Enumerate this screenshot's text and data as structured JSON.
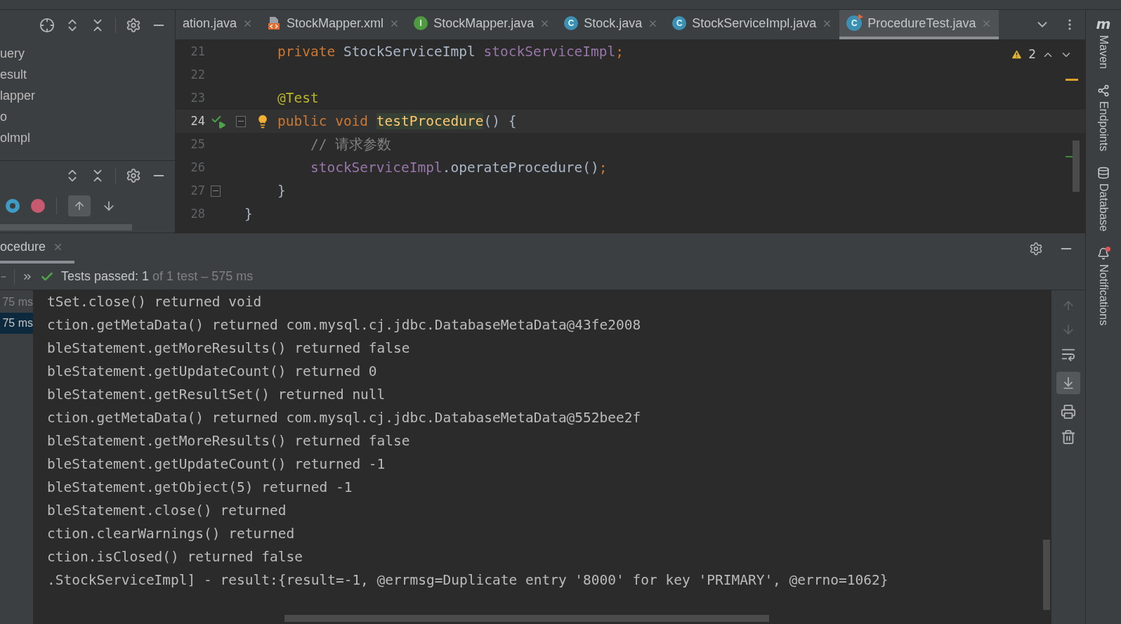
{
  "left_panel": {
    "tree_items": [
      "uery",
      "esult",
      "lapper",
      "o",
      "olmpl"
    ]
  },
  "editor": {
    "tabs": [
      {
        "label": "ation.java",
        "kind": "none",
        "selected": false
      },
      {
        "label": "StockMapper.xml",
        "kind": "xml",
        "selected": false
      },
      {
        "label": "StockMapper.java",
        "kind": "interface",
        "glyph": "I",
        "selected": false
      },
      {
        "label": "Stock.java",
        "kind": "class",
        "glyph": "C",
        "selected": false
      },
      {
        "label": "StockServiceImpl.java",
        "kind": "class",
        "glyph": "C",
        "selected": false
      },
      {
        "label": "ProcedureTest.java",
        "kind": "test",
        "glyph": "C",
        "selected": true
      }
    ],
    "warning_count": "2",
    "lines": [
      {
        "number": "21",
        "current": false,
        "tokens": [
          {
            "text": "    private ",
            "kind": "keyword"
          },
          {
            "text": "StockServiceImpl ",
            "kind": "plain"
          },
          {
            "text": "stockServiceImpl",
            "kind": "field"
          },
          {
            "text": ";",
            "kind": "keyword"
          }
        ]
      },
      {
        "number": "22",
        "current": false
      },
      {
        "number": "23",
        "current": false,
        "tokens": [
          {
            "text": "    @Test",
            "kind": "annotation"
          }
        ]
      },
      {
        "number": "24",
        "current": true,
        "marks": [
          {
            "kind": "run"
          },
          {
            "kind": "fold-start"
          },
          {
            "kind": "bulb"
          }
        ],
        "tokens": [
          {
            "text": "    public void ",
            "kind": "keyword"
          },
          {
            "text": "testProcedure",
            "kind": "method",
            "highlighted": true
          },
          {
            "text": "() {",
            "kind": "plain"
          }
        ]
      },
      {
        "number": "25",
        "current": false,
        "tokens": [
          {
            "text": "        // 请求参数",
            "kind": "comment"
          }
        ]
      },
      {
        "number": "26",
        "current": false,
        "tokens": [
          {
            "text": "        stockServiceImpl",
            "kind": "field"
          },
          {
            "text": ".operateProcedure()",
            "kind": "plain"
          },
          {
            "text": ";",
            "kind": "keyword"
          }
        ]
      },
      {
        "number": "27",
        "current": false,
        "marks": [
          {
            "kind": "fold-end"
          }
        ],
        "tokens": [
          {
            "text": "    }",
            "kind": "plain"
          }
        ]
      },
      {
        "number": "28",
        "current": false,
        "tokens": [
          {
            "text": "}",
            "kind": "plain"
          }
        ]
      }
    ]
  },
  "right_sidebar": [
    {
      "label": "Maven",
      "kind": "maven",
      "glyph": "m"
    },
    {
      "label": "Endpoints",
      "kind": "endpoints"
    },
    {
      "label": "Database",
      "kind": "database"
    },
    {
      "label": "Notifications",
      "kind": "notifications"
    }
  ],
  "run_panel": {
    "tab": "ocedure",
    "status": {
      "passed": "Tests passed: 1",
      "rest": "of 1 test – 575 ms"
    },
    "durations": [
      {
        "text": "75 ms",
        "selected": false
      },
      {
        "text": "75 ms",
        "selected": true
      }
    ],
    "console_lines": [
      "tSet.close() returned void",
      "ction.getMetaData() returned com.mysql.cj.jdbc.DatabaseMetaData@43fe2008",
      "bleStatement.getMoreResults() returned false",
      "bleStatement.getUpdateCount() returned 0",
      "bleStatement.getResultSet() returned null",
      "ction.getMetaData() returned com.mysql.cj.jdbc.DatabaseMetaData@552bee2f",
      "bleStatement.getMoreResults() returned false",
      "bleStatement.getUpdateCount() returned -1",
      "bleStatement.getObject(5) returned -1",
      "bleStatement.close() returned",
      "ction.clearWarnings() returned",
      "ction.isClosed() returned false",
      ".StockServiceImpl] - result:{result=-1, @errmsg=Duplicate entry '8000' for key 'PRIMARY', @errno=1062}"
    ]
  }
}
